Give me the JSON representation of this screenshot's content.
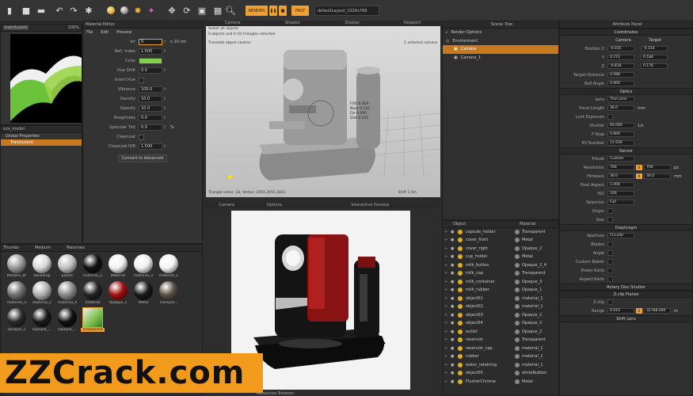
{
  "toolbar": {
    "render_chip": "RENDER",
    "layout_dropdown": "defaultLayout_1024x768",
    "chip2": "FAST"
  },
  "left_panel": {
    "title": "translucent",
    "zoom": "100%",
    "tree_root": "xxx_model",
    "tree_items": [
      "Global Properties",
      "Translucent"
    ]
  },
  "material_editor": {
    "title": "Material Editor",
    "menu": [
      "File",
      "Edit",
      "Preview"
    ],
    "rows": [
      {
        "label": "Ior",
        "value": "0",
        "extra": "x 10 cm"
      },
      {
        "label": "Refl. Index",
        "value": "1.500"
      },
      {
        "label": "Color",
        "value": ""
      },
      {
        "label": "Hue Shift",
        "value": "0.0"
      },
      {
        "label": "Invert Hue",
        "value": ""
      },
      {
        "label": "Vibrance",
        "value": "100.0"
      },
      {
        "label": "Density",
        "value": "10.0"
      },
      {
        "label": "Opacity",
        "value": "10.0"
      },
      {
        "label": "Roughness",
        "value": "0.0"
      },
      {
        "label": "Specular Tint",
        "value": "0.0",
        "extra": "%"
      },
      {
        "label": "Clearcoat",
        "value": ""
      },
      {
        "label": "Clearcoat IOR",
        "value": "1.500"
      }
    ],
    "convert_button": "Convert to Advanced"
  },
  "viewport_top": {
    "tabs": [
      "Camera",
      "Shaded",
      "Display",
      "Viewport"
    ],
    "info_line1": "Select all objects",
    "info_line2": "0 objects and 0 (0) triangles selected",
    "info_line3": "Translate object centres",
    "camera_label": "1 selected camera",
    "stats": [
      "FOV 0.469",
      "Near 0.145",
      "Far 0.690",
      "Dist 0.542"
    ],
    "footer_left": "Triangle index: 18, Vertex: 3591,3655,3821",
    "footer_right": "Shift 1.0m"
  },
  "viewport_bottom": {
    "tabs": [
      "Camera",
      "Options",
      "",
      "Interactive Preview",
      ""
    ],
    "footer": "Resources Browser"
  },
  "materials_panel": {
    "header_left": "Thumbs",
    "header_mid": "Medium",
    "header_right": "Materials",
    "items": [
      {
        "label": "Metallic_th",
        "color": "#9a9a9a"
      },
      {
        "label": "backdrop",
        "color": "#d8d8d8"
      },
      {
        "label": "plastic",
        "color": "#c0c0c0"
      },
      {
        "label": "material_2",
        "color": "#111111"
      },
      {
        "label": "Material",
        "color": "#f2f2f2"
      },
      {
        "label": "material_3",
        "color": "#f0f0f0"
      },
      {
        "label": "material_1",
        "color": "#f5f5f5"
      },
      {
        "label": "material_3",
        "color": "#707070"
      },
      {
        "label": "material_1",
        "color": "#b0b0b0"
      },
      {
        "label": "material_4",
        "color": "#8a8a8a"
      },
      {
        "label": "material",
        "color": "#222222"
      },
      {
        "label": "Opaque_1",
        "color": "#a01010"
      },
      {
        "label": "Metal",
        "color": "#1a1a1a"
      },
      {
        "label": "Transpar...",
        "color": "#5a5045"
      },
      {
        "label": "Opaque_2",
        "color": "#2a2a2a"
      },
      {
        "label": "Opaque_...",
        "color": "#1a1a1a"
      },
      {
        "label": "Opaque_...",
        "color": "#111111"
      },
      {
        "label": "Translucent",
        "color": "#5a9a3a"
      }
    ]
  },
  "scene_tree": {
    "title": "Scene Tree",
    "items": [
      "Render Options",
      "Environment",
      "Camera",
      "Camera_1"
    ]
  },
  "object_list": {
    "col_object": "Object",
    "col_material": "Material",
    "rows": [
      {
        "object": "capsule_holder",
        "material": "Transparent"
      },
      {
        "object": "cover_front",
        "material": "Metal"
      },
      {
        "object": "cover_right",
        "material": "Opaque_2"
      },
      {
        "object": "cup_holder",
        "material": "Metal"
      },
      {
        "object": "milk_button",
        "material": "Opaque_2_4"
      },
      {
        "object": "milk_cap",
        "material": "Transparent"
      },
      {
        "object": "milk_container",
        "material": "Opaque_3"
      },
      {
        "object": "milk_rubber",
        "material": "Opaque_1"
      },
      {
        "object": "object01",
        "material": "material_1"
      },
      {
        "object": "object02",
        "material": "material_1"
      },
      {
        "object": "object03",
        "material": "Opaque_2"
      },
      {
        "object": "object04",
        "material": "Opaque_2"
      },
      {
        "object": "outlet",
        "material": "Opaque_2"
      },
      {
        "object": "reservoir",
        "material": "Transparent"
      },
      {
        "object": "reservoir_cap",
        "material": "material_1"
      },
      {
        "object": "rubber",
        "material": "material_1"
      },
      {
        "object": "water_retaining",
        "material": "material_1"
      },
      {
        "object": "object05",
        "material": "whiteRubber"
      },
      {
        "object": "FlusherChrome",
        "material": "Metal"
      }
    ]
  },
  "attribute_panel": {
    "title": "Attribute Panel",
    "coordinates_head": "Coordinates",
    "col_camera": "Camera",
    "col_target": "Target",
    "coords": [
      {
        "label": "Position X",
        "cam": "-0.035",
        "tgt": "-0.154"
      },
      {
        "label": "Y",
        "cam": "0.272",
        "tgt": "0.184"
      },
      {
        "label": "Z",
        "cam": "-0.818",
        "tgt": "0.176"
      }
    ],
    "target_distance": {
      "label": "Target Distance",
      "value": "0.588"
    },
    "roll_angle": {
      "label": "Roll Angle",
      "value": "0.000"
    },
    "optics_head": "Optics",
    "optics": [
      {
        "label": "Lens",
        "value": "Thin Lens"
      },
      {
        "label": "Focal Length",
        "value": "36.0",
        "unit": "mm"
      },
      {
        "label": "Lock Exposure",
        "value": ""
      },
      {
        "label": "Shutter",
        "value": "60.000",
        "unit": "1/s"
      },
      {
        "label": "F-Stop",
        "value": "5.600"
      },
      {
        "label": "EV Number",
        "value": "11.939"
      }
    ],
    "sensor_head": "Sensor",
    "sensor": [
      {
        "label": "Preset",
        "value": "Custom"
      },
      {
        "label": "Resolution",
        "value": "700",
        "value2": "700",
        "unit": "px"
      },
      {
        "label": "Filmback",
        "value": "36.0",
        "value2": "36.0",
        "unit": "mm"
      },
      {
        "label": "Pixel Aspect",
        "value": "1.000"
      },
      {
        "label": "ISO",
        "value": "100"
      },
      {
        "label": "Selection",
        "value": "Full"
      },
      {
        "label": "Origin",
        "value": ""
      },
      {
        "label": "Size",
        "value": ""
      }
    ],
    "diaphragm_head": "Diaphragm",
    "diaphragm": [
      {
        "label": "Aperture",
        "value": "Circular"
      },
      {
        "label": "Blades",
        "value": ""
      },
      {
        "label": "Angle",
        "value": ""
      },
      {
        "label": "Custom Bokeh",
        "value": ""
      },
      {
        "label": "Power Ratio",
        "value": ""
      },
      {
        "label": "Aspect Ratio",
        "value": ""
      }
    ],
    "shutter_head": "Rotary Disc Shutter",
    "zclip_head": "Z-clip Planes",
    "zclip": [
      {
        "label": "Z-clip",
        "value": ""
      },
      {
        "label": "Range",
        "value": "0.010",
        "value2": "32768.000",
        "unit": "m"
      }
    ],
    "shift_head": "Shift Lens"
  },
  "watermark": "ZZCrack.com",
  "colors": {
    "accent": "#f0a030",
    "selection": "#c8781e",
    "watermark": "#f29a1b"
  }
}
